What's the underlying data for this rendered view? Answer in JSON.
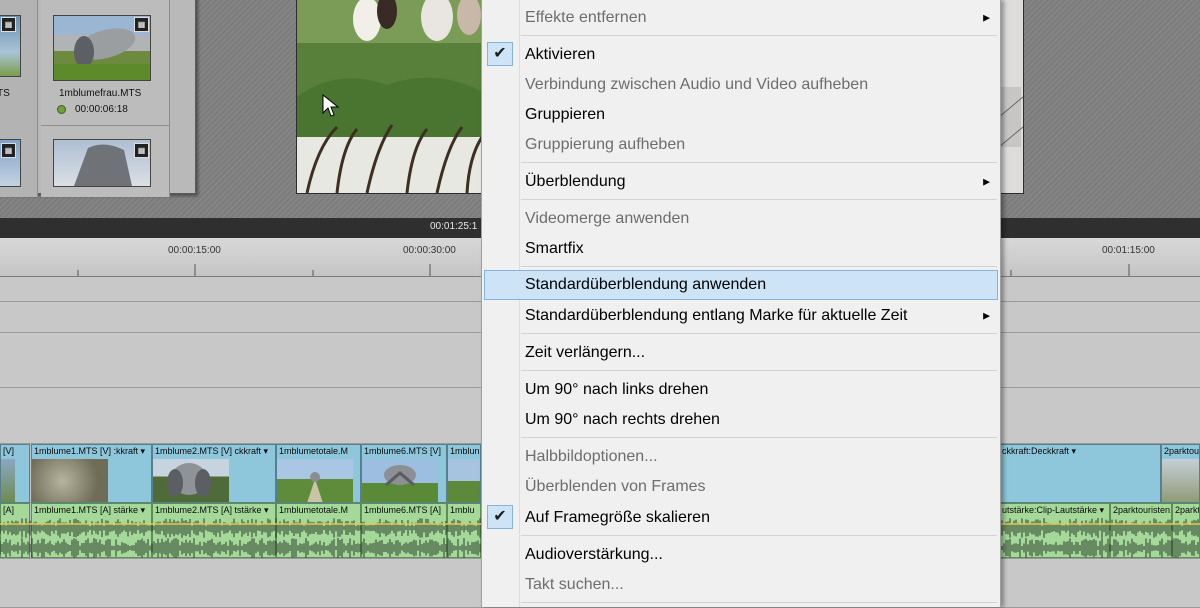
{
  "media_bin": {
    "clip_name": "1mblumefrau.MTS",
    "clip_duration": "00:00:06:18",
    "cut_label": "TS"
  },
  "timeline": {
    "current_time": "00:01:25:1",
    "ruler_labels": [
      "00:00:15:00",
      "00:00:30:00",
      "00:01:15:00"
    ],
    "video_clips": [
      "[V]",
      "1mblume1.MTS [V] :kkraft ▾",
      "1mblume2.MTS [V]  ckkraft ▾",
      "1mblumetotale.M",
      "1mblume6.MTS [V]",
      "1mblun",
      "ckkraft:Deckkraft ▾",
      "2parktou"
    ],
    "audio_clips": [
      "[A]",
      "1mblume1.MTS [A]  stärke ▾",
      "1mblume2.MTS [A]  tstärke ▾",
      "1mblumetotale.M",
      "1mblume6.MTS [A]",
      "1mblu",
      "utstärke:Clip-Lautstärke ▾",
      "2parktouristen.MTS",
      "2parktour"
    ]
  },
  "context_menu": {
    "items": [
      {
        "label": "Effekte entfernen",
        "disabled": true,
        "submenu": true
      },
      {
        "label": "Aktivieren",
        "checked": true
      },
      {
        "label": "Verbindung zwischen Audio und Video aufheben",
        "disabled": true
      },
      {
        "label": "Gruppieren"
      },
      {
        "label": "Gruppierung aufheben",
        "disabled": true
      },
      {
        "label": "Überblendung",
        "submenu": true
      },
      {
        "label": "Videomerge anwenden",
        "disabled": true
      },
      {
        "label": "Smartfix"
      },
      {
        "label": "Standardüberblendung anwenden",
        "highlighted": true
      },
      {
        "label": "Standardüberblendung entlang Marke für aktuelle Zeit",
        "submenu": true
      },
      {
        "label": "Zeit verlängern..."
      },
      {
        "label": "Um 90° nach links drehen"
      },
      {
        "label": "Um 90° nach rechts drehen"
      },
      {
        "label": "Halbbildoptionen...",
        "disabled": true
      },
      {
        "label": "Überblenden von Frames",
        "disabled": true
      },
      {
        "label": "Auf Framegröße skalieren",
        "checked": true
      },
      {
        "label": "Audioverstärkung..."
      },
      {
        "label": "Takt suchen...",
        "disabled": true
      }
    ]
  },
  "colors": {
    "menu_highlight": "#cde4f7",
    "video_clip": "#8ec7dc",
    "audio_clip": "#a4d99a"
  }
}
